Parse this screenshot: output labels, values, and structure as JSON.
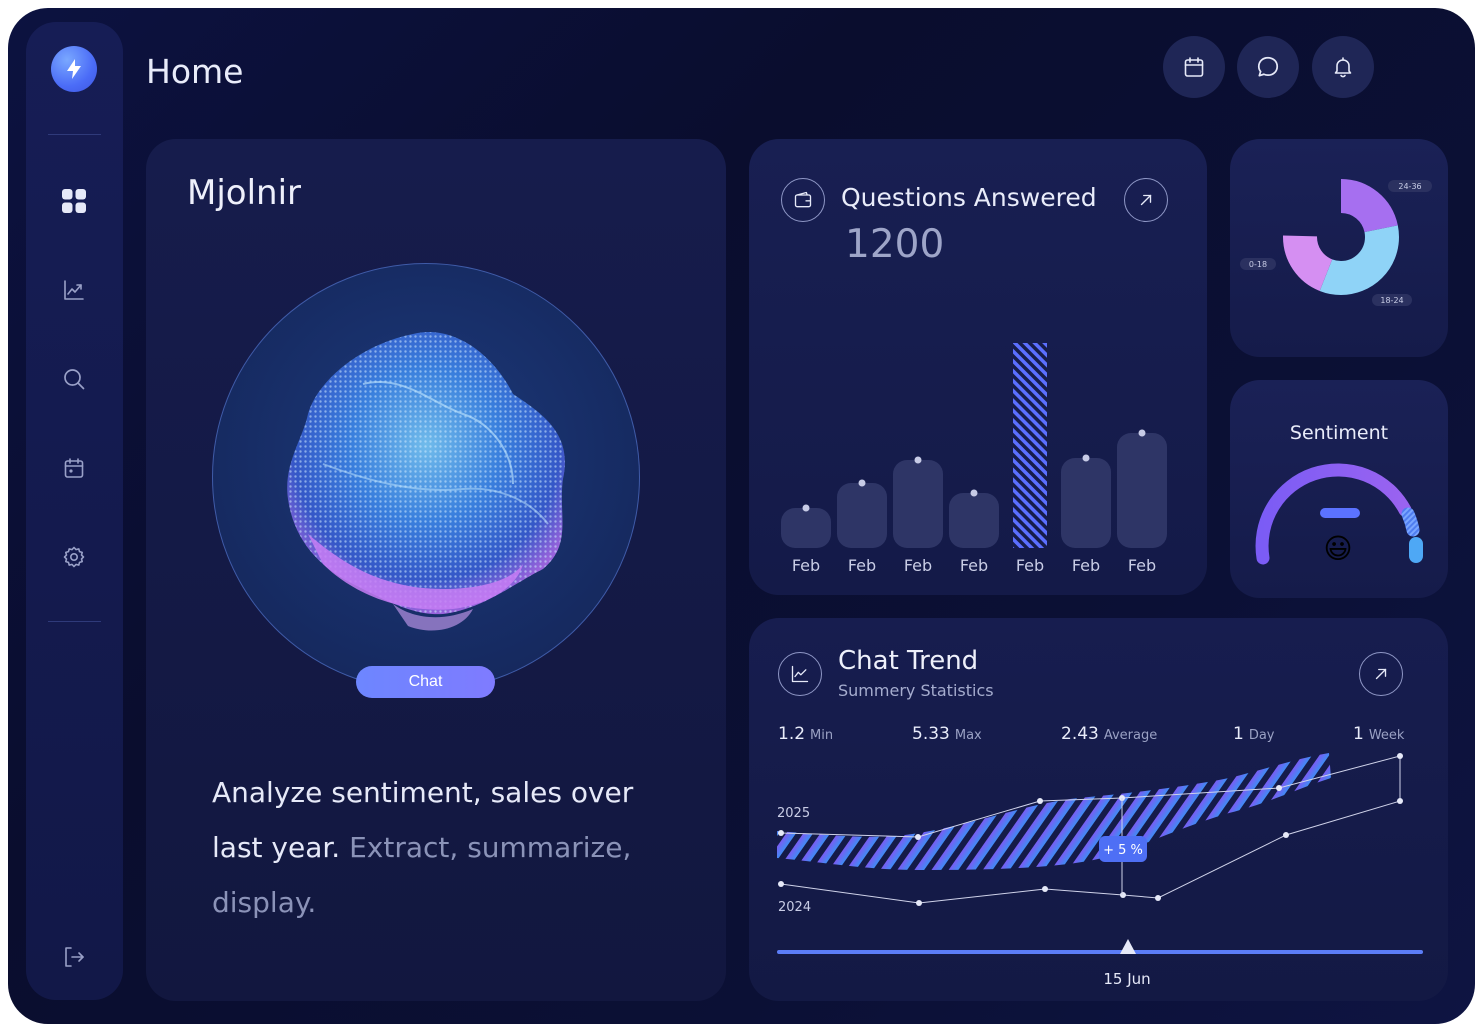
{
  "header": {
    "title": "Home"
  },
  "hero": {
    "title": "Mjolnir",
    "chat_label": "Chat",
    "text_main": "Analyze sentiment, sales over last year.",
    "text_muted": " Extract, summarize, display."
  },
  "questions": {
    "title": "Questions Answered",
    "value": "1200"
  },
  "donut": {
    "labels": [
      "24-36",
      "0-18",
      "18-24"
    ]
  },
  "sentiment": {
    "title": "Sentiment",
    "emoji": "😃"
  },
  "trend": {
    "title": "Chat Trend",
    "subtitle": "Summery Statistics",
    "stats": [
      {
        "value": "1.2",
        "unit": "Min"
      },
      {
        "value": "5.33",
        "unit": "Max"
      },
      {
        "value": "2.43",
        "unit": "Average"
      },
      {
        "value": "1",
        "unit": "Day"
      },
      {
        "value": "1",
        "unit": "Week"
      }
    ],
    "label_2025": "2025",
    "label_2024": "2024",
    "badge": "+ 5 %",
    "slider_label": "15 Jun"
  },
  "chart_data": {
    "type": "bar",
    "categories": [
      "Feb",
      "Feb",
      "Feb",
      "Feb",
      "Feb",
      "Feb",
      "Feb"
    ],
    "values": [
      40,
      65,
      88,
      55,
      205,
      90,
      115
    ],
    "highlight_index": 4,
    "ylim": [
      0,
      210
    ]
  },
  "colors": {
    "accent": "#6d86ff",
    "bar": "#2e3566",
    "highlight": "#5b6fff",
    "donut_purple": "#a66ff0",
    "donut_pink": "#d58ff2",
    "donut_blue": "#8fd3f7"
  }
}
